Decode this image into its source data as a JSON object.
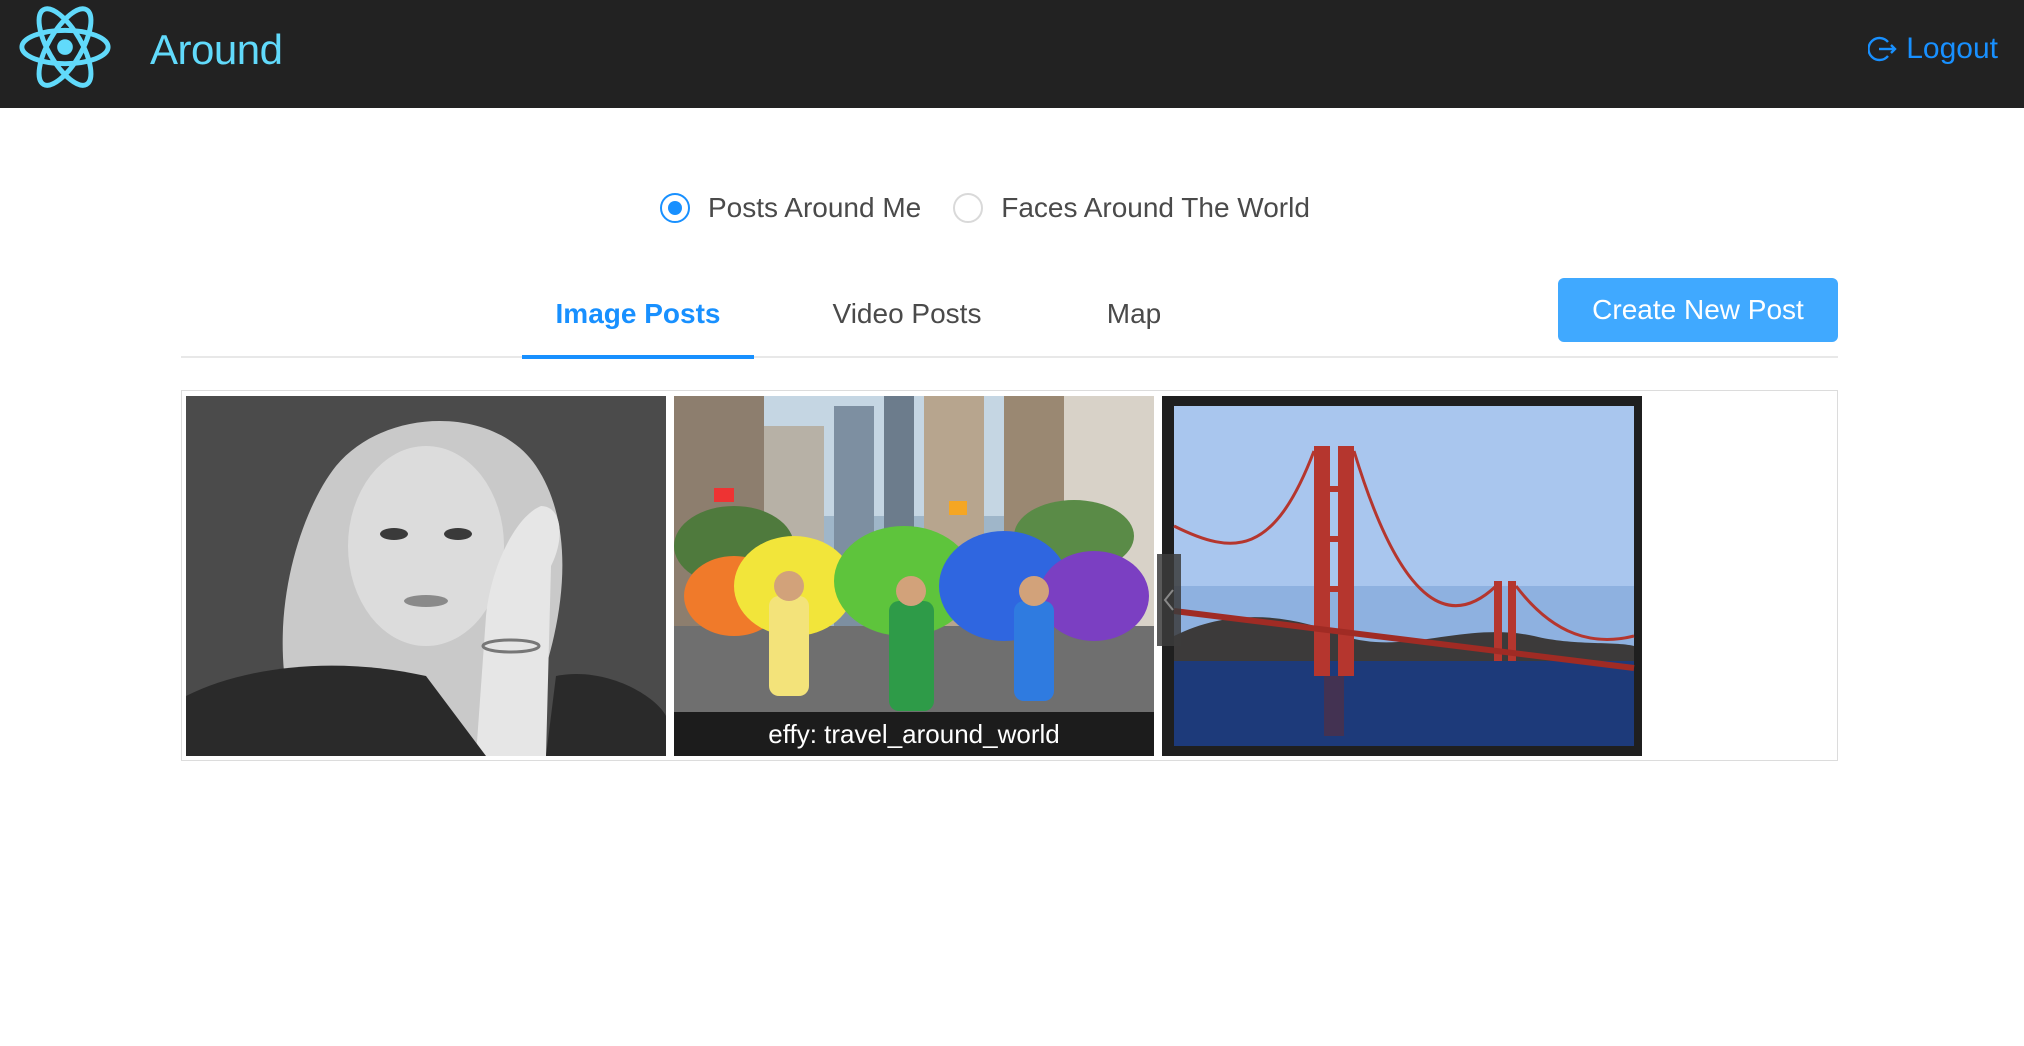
{
  "header": {
    "app_title": "Around",
    "logout_label": "Logout",
    "logo_icon": "react-atom-icon",
    "accent_color": "#61dafb",
    "link_color": "#1890ff"
  },
  "filter": {
    "options": [
      {
        "label": "Posts Around Me",
        "checked": true
      },
      {
        "label": "Faces Around The World",
        "checked": false
      }
    ]
  },
  "tabs": {
    "items": [
      {
        "label": "Image Posts",
        "active": true
      },
      {
        "label": "Video Posts",
        "active": false
      },
      {
        "label": "Map",
        "active": false
      }
    ],
    "create_button_label": "Create New Post"
  },
  "gallery": {
    "items": [
      {
        "subject": "portrait",
        "caption": ""
      },
      {
        "subject": "parade",
        "caption": "effy: travel_around_world"
      },
      {
        "subject": "golden-gate-bridge",
        "caption": ""
      }
    ]
  }
}
